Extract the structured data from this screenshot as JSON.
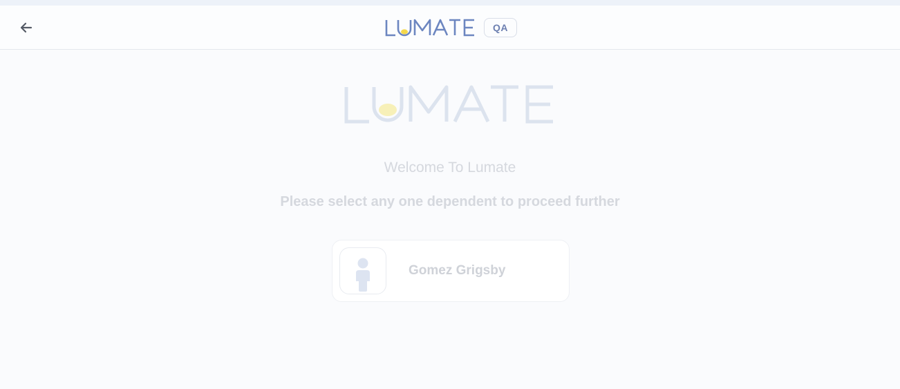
{
  "header": {
    "back_icon": "arrow-left-icon",
    "brand_name": "LUMATE",
    "env_badge": "QA"
  },
  "main": {
    "hero_brand": "LUMATE",
    "welcome_text": "Welcome To Lumate",
    "instruction_text": "Please select any one dependent to proceed further",
    "dependents": [
      {
        "name": "Gomez Grigsby",
        "avatar_icon": "person-icon"
      }
    ]
  },
  "colors": {
    "brand_blue": "#6c86c0",
    "brand_yellow": "#f5d84a",
    "faded_brand": "#dce3ee",
    "muted_text": "#d5d8de"
  }
}
